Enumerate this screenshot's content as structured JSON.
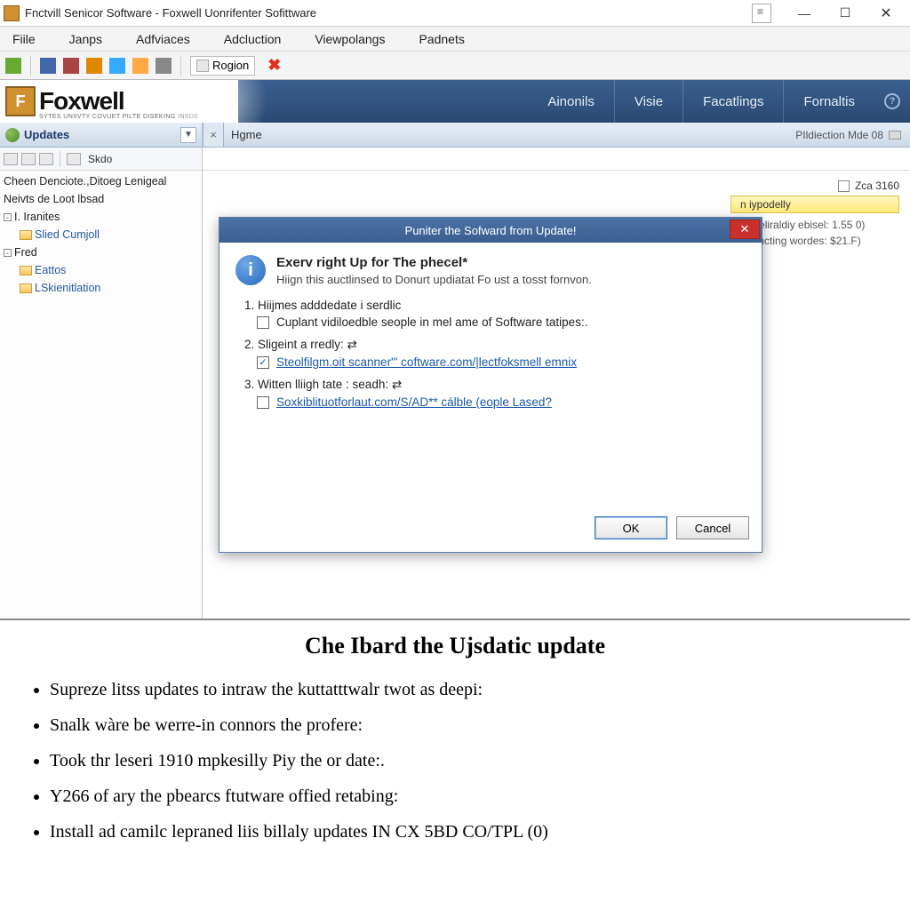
{
  "titlebar": {
    "title": "Fnctvill Senicor Software  -  Foxwell Uonrifenter Sofittware"
  },
  "menubar": [
    "Fiile",
    "Janps",
    "Adfviaces",
    "Adcluction",
    "Viewpolangs",
    "Padnets"
  ],
  "toolbar": {
    "region_label": "Rogion"
  },
  "brand": {
    "name": "Foxwell",
    "sub": "SYTES  UNIIVTY COVUET PILTE DISEKING INSDE",
    "tabs": [
      "Ainonils",
      "Visie",
      "Facatlings",
      "Fornaltis"
    ]
  },
  "subnav": {
    "updates": "Updates",
    "breadcrumb": "Hgme",
    "right": "PIldiection Mde  08"
  },
  "sidebar": {
    "toolbar_label": "Skdo",
    "items": [
      "Cheen Denciote.,Ditoeg Lenigeal",
      "Neivts de Loot lbsad",
      "I. Iranites",
      "Slied Cumjoll",
      "Fred",
      "Eattos",
      "LSkienitlation"
    ]
  },
  "rightpanel": {
    "zca": "Zca 3160",
    "pill": "n iypodelly",
    "meta1": "ing Yeliraldiy ebisel: 1.55 0)",
    "meta2": "in soncting wordes: $21.F)"
  },
  "dialog": {
    "title": "Puniter the Sofward from Update!",
    "head": "Exerv right Up for The phecel*",
    "sub": "Hiign this auctlinsed to Donurt updiatat Fo ust a tosst fornvon.",
    "item1_label": "1. Hiijmes adddedate i serdlic",
    "item1_opt": "Cuplant vidiloedble seople in mel ame of Software tatipes:.",
    "item2_label": "2. Sligeint a rredly: ⇄",
    "item2_opt": "Steolfilgm.oit scanner'\" coftware.com/|lectfoksmell emnix",
    "item3_label": "3. Witten lliigh tate : seadh: ⇄",
    "item3_opt": "Soxkiblituotforlaut.com/S/AD** cálble (eople Lased?",
    "ok": "OK",
    "cancel": "Cancel"
  },
  "article": {
    "title": "Che Ibard the Ujsdatic update",
    "bullets": [
      "Supreze litss updates to intraw the kuttatttwalr twot as deepi:",
      "Snalk wàre be werre-in connors the profere:",
      "Took thr leseri 1910 mpkesilly Piy the or date:.",
      "Y266 of ary the pbearcs ftutware offied retabing:",
      "Install ad camilc lepraned liis billaly updates IN CX 5BD CO/TPL (0)"
    ]
  }
}
